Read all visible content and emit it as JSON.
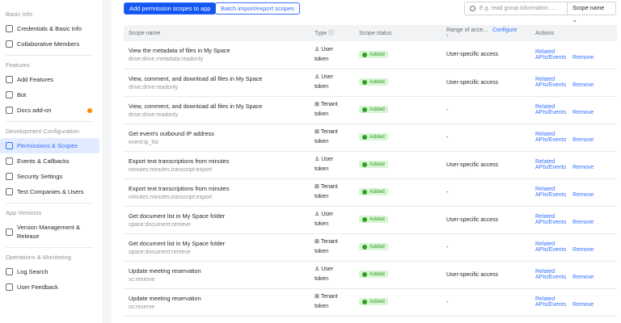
{
  "sidebar": {
    "sections": [
      {
        "title": "Basic Info",
        "items": [
          {
            "label": "Credentials & Basic Info",
            "icon": "id-card-icon"
          },
          {
            "label": "Collaborative Members",
            "icon": "user-icon"
          }
        ]
      },
      {
        "title": "Features",
        "items": [
          {
            "label": "Add Features",
            "icon": "grid-add-icon"
          },
          {
            "label": "Bot",
            "icon": "bot-icon"
          },
          {
            "label": "Docs add-on",
            "icon": "docs-icon",
            "badge": true
          }
        ]
      },
      {
        "title": "Development Configuration",
        "items": [
          {
            "label": "Permissions & Scopes",
            "icon": "lock-icon",
            "active": true
          },
          {
            "label": "Events & Callbacks",
            "icon": "event-icon"
          },
          {
            "label": "Security Settings",
            "icon": "shield-icon"
          },
          {
            "label": "Test Companies & Users",
            "icon": "test-icon"
          }
        ]
      },
      {
        "title": "App Versions",
        "items": [
          {
            "label": "Version Management & Release",
            "icon": "upload-icon"
          }
        ]
      },
      {
        "title": "Operations & Monitoring",
        "items": [
          {
            "label": "Log Search",
            "icon": "log-icon"
          },
          {
            "label": "User Feedback",
            "icon": "feedback-icon"
          }
        ]
      }
    ]
  },
  "toolbar": {
    "add_label": "Add permission scopes to app",
    "batch_label": "Batch import/export scopes",
    "search_placeholder": "E.g. read group information, ...",
    "search_by": "Scope name"
  },
  "table": {
    "headers": {
      "name": "Scope name",
      "type": "Type ⓘ",
      "status": "Scope status",
      "range": "Range of acce...",
      "configure": "Configure ›",
      "actions": "Actions"
    },
    "rows": [
      {
        "name": "View the metadata of files in My Space",
        "key": "drive:drive.metadata:readonly",
        "type": "User",
        "type2": "token",
        "status": "Added",
        "range": "User-specific access"
      },
      {
        "name": "View, comment, and download all files in My Space",
        "key": "drive:drive:readonly",
        "type": "User",
        "type2": "token",
        "status": "Added",
        "range": "User-specific access"
      },
      {
        "name": "View, comment, and download all files in My Space",
        "key": "drive:drive:readonly",
        "type": "Tenant",
        "type2": "token",
        "status": "Added",
        "range": "-"
      },
      {
        "name": "Get event's outbound IP address",
        "key": "event:ip_list",
        "type": "Tenant",
        "type2": "token",
        "status": "Added",
        "range": "-"
      },
      {
        "name": "Export text transcriptions from minutes",
        "key": "minutes:minutes.transcript:export",
        "type": "User",
        "type2": "token",
        "status": "Added",
        "range": "User-specific access"
      },
      {
        "name": "Export text transcriptions from minutes",
        "key": "minutes:minutes.transcript:export",
        "type": "Tenant",
        "type2": "token",
        "status": "Added",
        "range": "-"
      },
      {
        "name": "Get document list in My Space folder",
        "key": "space:document:retrieve",
        "type": "User",
        "type2": "token",
        "status": "Added",
        "range": "User-specific access"
      },
      {
        "name": "Get document list in My Space folder",
        "key": "space:document:retrieve",
        "type": "Tenant",
        "type2": "token",
        "status": "Added",
        "range": "-"
      },
      {
        "name": "Update meeting reservation",
        "key": "vc:reserve",
        "type": "User",
        "type2": "token",
        "status": "Added",
        "range": "User-specific access"
      },
      {
        "name": "Update meeting reservation",
        "key": "vc:reserve",
        "type": "Tenant",
        "type2": "token",
        "status": "Added",
        "range": "-"
      }
    ],
    "related_label": "Related APIs/Events",
    "remove_label": "Remove"
  }
}
